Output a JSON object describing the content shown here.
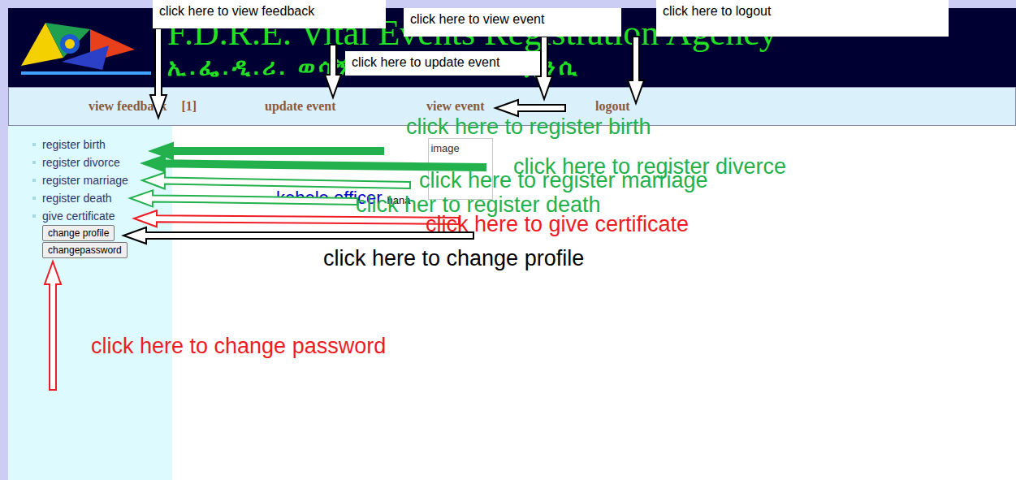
{
  "banner": {
    "title": "F.D.R.E. Vital Events Registration Agency",
    "subtitle": "ኢ.ፌ.ዲ.ሪ. ወሳኝ ኩነት ምዝገባ ኤጀንሲ"
  },
  "nav": [
    {
      "label": "view feedback",
      "badge": "[1]"
    },
    {
      "label": "update event",
      "badge": ""
    },
    {
      "label": "view event",
      "badge": ""
    },
    {
      "label": "logout",
      "badge": ""
    }
  ],
  "sidebar": {
    "links": [
      "register birth",
      "register divorce",
      "register marriage",
      "register death",
      "give certificate"
    ],
    "buttons": [
      "change profile",
      "changepassword"
    ]
  },
  "content": {
    "image_alt": "image",
    "role": "kebele officer",
    "user": "hana"
  },
  "annotations": [
    {
      "text": "click here to view feedback",
      "kind": "box",
      "color": "#000000"
    },
    {
      "text": "click here to view event",
      "kind": "box",
      "color": "#000000"
    },
    {
      "text": "click here to logout",
      "kind": "box",
      "color": "#000000"
    },
    {
      "text": "click here to update event",
      "kind": "box",
      "color": "#000000"
    },
    {
      "text": "click here to register birth",
      "kind": "caption",
      "color": "#22b14c"
    },
    {
      "text": "click here to register diverce",
      "kind": "caption",
      "color": "#22b14c"
    },
    {
      "text": "click here to register marriage",
      "kind": "caption",
      "color": "#22b14c"
    },
    {
      "text": "click her to register death",
      "kind": "caption",
      "color": "#22b14c"
    },
    {
      "text": "click here to give certificate",
      "kind": "caption",
      "color": "#ed1c24"
    },
    {
      "text": "click here to change profile",
      "kind": "caption",
      "color": "#000000"
    },
    {
      "text": "click here to change password",
      "kind": "caption",
      "color": "#ed1c24"
    }
  ]
}
